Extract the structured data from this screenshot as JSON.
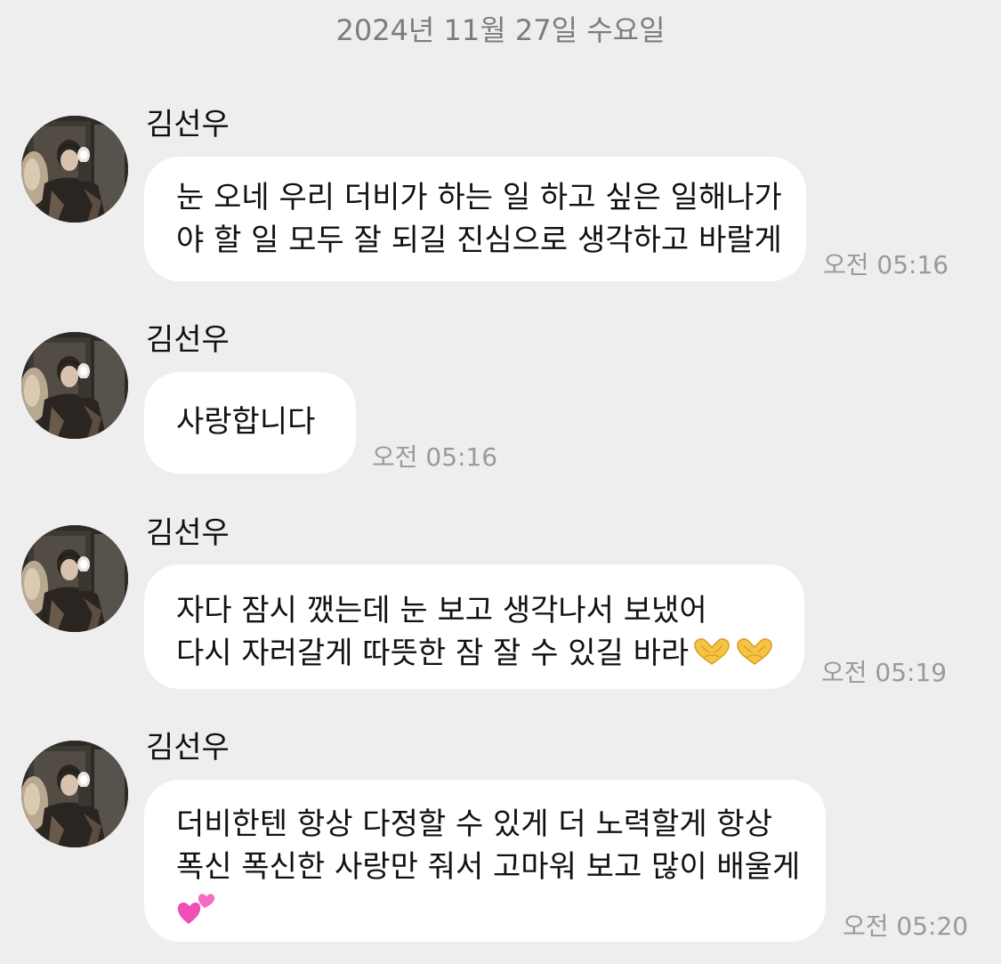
{
  "date_divider": "2024년 11월 27일 수요일",
  "messages": [
    {
      "sender": "김선우",
      "lines": [
        "눈 오네 우리 더비가 하는 일 하고 싶은 일해나가",
        "야 할 일 모두 잘 되길 진심으로 생각하고 바랄게"
      ],
      "time": "오전 05:16"
    },
    {
      "sender": "김선우",
      "lines": [
        "사랑합니다"
      ],
      "time": "오전 05:16"
    },
    {
      "sender": "김선우",
      "lines": [
        "자다 잠시 깼는데 눈 보고 생각나서 보냈어",
        "다시 자러갈게 따뜻한 잠 잘 수 있길 바라"
      ],
      "emoji": [
        "heart-hands-emoji",
        "heart-hands-emoji"
      ],
      "time": "오전 05:19"
    },
    {
      "sender": "김선우",
      "lines": [
        "더비한텐 항상 다정할 수 있게 더 노력할게 항상",
        "폭신 폭신한 사랑만 줘서 고마워 보고 많이 배울게"
      ],
      "emoji": [
        "two-hearts-emoji"
      ],
      "time": "오전 05:20"
    }
  ],
  "colors": {
    "background": "#eeeeee",
    "bubble": "#ffffff",
    "time_text": "#9a9a9a",
    "date_text": "#7d7d7d"
  }
}
